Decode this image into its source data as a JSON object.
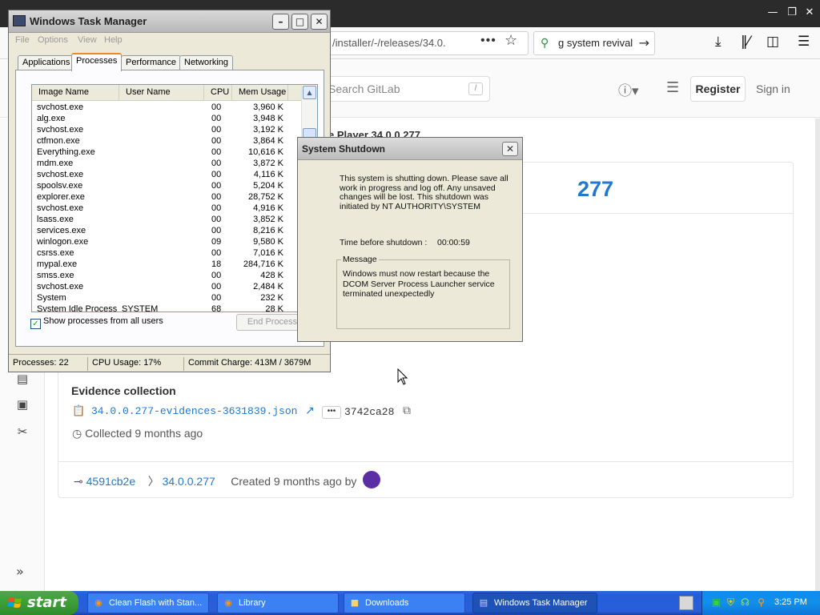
{
  "browser": {
    "url": "/installer/-/releases/34.0.",
    "search_text": "g system revival"
  },
  "gitlab": {
    "search_placeholder": "Search GitLab",
    "search_shortcut": "/",
    "register_label": "Register",
    "signin_label": "Sign in",
    "release_title_partial": "e Player 34.0.0.277",
    "version_partial": "277",
    "evidence_title": "Evidence collection",
    "evidence_file": "34.0.0.277-evidences-3631839.json",
    "evidence_hash": "3742ca28",
    "evidence_more": "•••",
    "collected": "Collected 9 months ago",
    "footer": {
      "commit": "4591cb2e",
      "tag": "34.0.0.277",
      "created": "Created 9 months ago by"
    }
  },
  "taskmgr": {
    "title": "Windows Task Manager",
    "menu": [
      "File",
      "Options",
      "View",
      "Help"
    ],
    "tabs": [
      "Applications",
      "Processes",
      "Performance",
      "Networking"
    ],
    "active_tab": "Processes",
    "columns": [
      "Image Name",
      "User Name",
      "CPU",
      "Mem Usage"
    ],
    "processes": [
      {
        "name": "svchost.exe",
        "user": "",
        "cpu": "00",
        "mem": "3,960 K"
      },
      {
        "name": "alg.exe",
        "user": "",
        "cpu": "00",
        "mem": "3,948 K"
      },
      {
        "name": "svchost.exe",
        "user": "",
        "cpu": "00",
        "mem": "3,192 K"
      },
      {
        "name": "ctfmon.exe",
        "user": "",
        "cpu": "00",
        "mem": "3,864 K"
      },
      {
        "name": "Everything.exe",
        "user": "",
        "cpu": "00",
        "mem": "10,616 K"
      },
      {
        "name": "mdm.exe",
        "user": "",
        "cpu": "00",
        "mem": "3,872 K"
      },
      {
        "name": "svchost.exe",
        "user": "",
        "cpu": "00",
        "mem": "4,116 K"
      },
      {
        "name": "spoolsv.exe",
        "user": "",
        "cpu": "00",
        "mem": "5,204 K"
      },
      {
        "name": "explorer.exe",
        "user": "",
        "cpu": "00",
        "mem": "28,752 K"
      },
      {
        "name": "svchost.exe",
        "user": "",
        "cpu": "00",
        "mem": "4,916 K"
      },
      {
        "name": "lsass.exe",
        "user": "",
        "cpu": "00",
        "mem": "3,852 K"
      },
      {
        "name": "services.exe",
        "user": "",
        "cpu": "00",
        "mem": "8,216 K"
      },
      {
        "name": "winlogon.exe",
        "user": "",
        "cpu": "09",
        "mem": "9,580 K"
      },
      {
        "name": "csrss.exe",
        "user": "",
        "cpu": "00",
        "mem": "7,016 K"
      },
      {
        "name": "mypal.exe",
        "user": "",
        "cpu": "18",
        "mem": "284,716 K"
      },
      {
        "name": "smss.exe",
        "user": "",
        "cpu": "00",
        "mem": "428 K"
      },
      {
        "name": "svchost.exe",
        "user": "",
        "cpu": "00",
        "mem": "2,484 K"
      },
      {
        "name": "System",
        "user": "",
        "cpu": "00",
        "mem": "232 K"
      },
      {
        "name": "System Idle Process",
        "user": "SYSTEM",
        "cpu": "68",
        "mem": "28 K"
      }
    ],
    "show_all_label": "Show processes from all users",
    "show_all_checked": true,
    "end_process_label": "End Process",
    "status": {
      "processes": "Processes: 22",
      "cpu": "CPU Usage: 17%",
      "commit": "Commit Charge: 413M / 3679M"
    }
  },
  "shutdown": {
    "title": "System Shutdown",
    "body": "This system is shutting down. Please save all work in progress and log off. Any unsaved changes will be lost. This shutdown was initiated by NT AUTHORITY\\SYSTEM",
    "timer_label": "Time before shutdown :",
    "timer_value": "00:00:59",
    "message_label": "Message",
    "message_text": "Windows must now restart because the DCOM Server Process Launcher service terminated unexpectedly"
  },
  "taskbar": {
    "start_label": "start",
    "tasks": [
      {
        "label": "Clean Flash with Stan...",
        "icon": "firefox-icon"
      },
      {
        "label": "Library",
        "icon": "firefox-icon"
      },
      {
        "label": "Downloads",
        "icon": "folder-icon"
      },
      {
        "label": "Windows Task Manager",
        "icon": "taskmgr-icon"
      }
    ],
    "clock": "3:25 PM"
  }
}
